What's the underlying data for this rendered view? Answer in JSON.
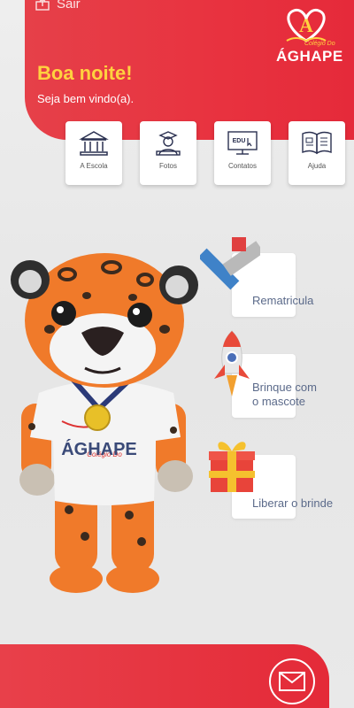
{
  "header": {
    "exit_label": "Sair",
    "greeting": "Boa noite!",
    "welcome": "Seja bem vindo(a).",
    "logo_small": "Colégio Do",
    "logo_name": "ÁGHAPE"
  },
  "tiles": [
    {
      "label": "A Escola",
      "icon": "school-building-icon"
    },
    {
      "label": "Fotos",
      "icon": "graduate-icon"
    },
    {
      "label": "Contatos",
      "icon": "edu-monitor-icon"
    },
    {
      "label": "Ajuda",
      "icon": "book-icon"
    }
  ],
  "actions": [
    {
      "label": "Rematricula",
      "icon": "ruler-pencil-icon"
    },
    {
      "label_line1": "Brinque com",
      "label_line2": "o mascote",
      "icon": "rocket-icon"
    },
    {
      "label": "Liberar o brinde",
      "icon": "gift-icon"
    }
  ],
  "mascot": {
    "shirt_text": "ÁGHAPE",
    "shirt_small": "Colégio Do"
  },
  "footer": {
    "icon": "mail-icon"
  },
  "colors": {
    "brand_red": "#e8323f",
    "greeting_yellow": "#ffd23f",
    "label_blue": "#5b6a8a"
  }
}
